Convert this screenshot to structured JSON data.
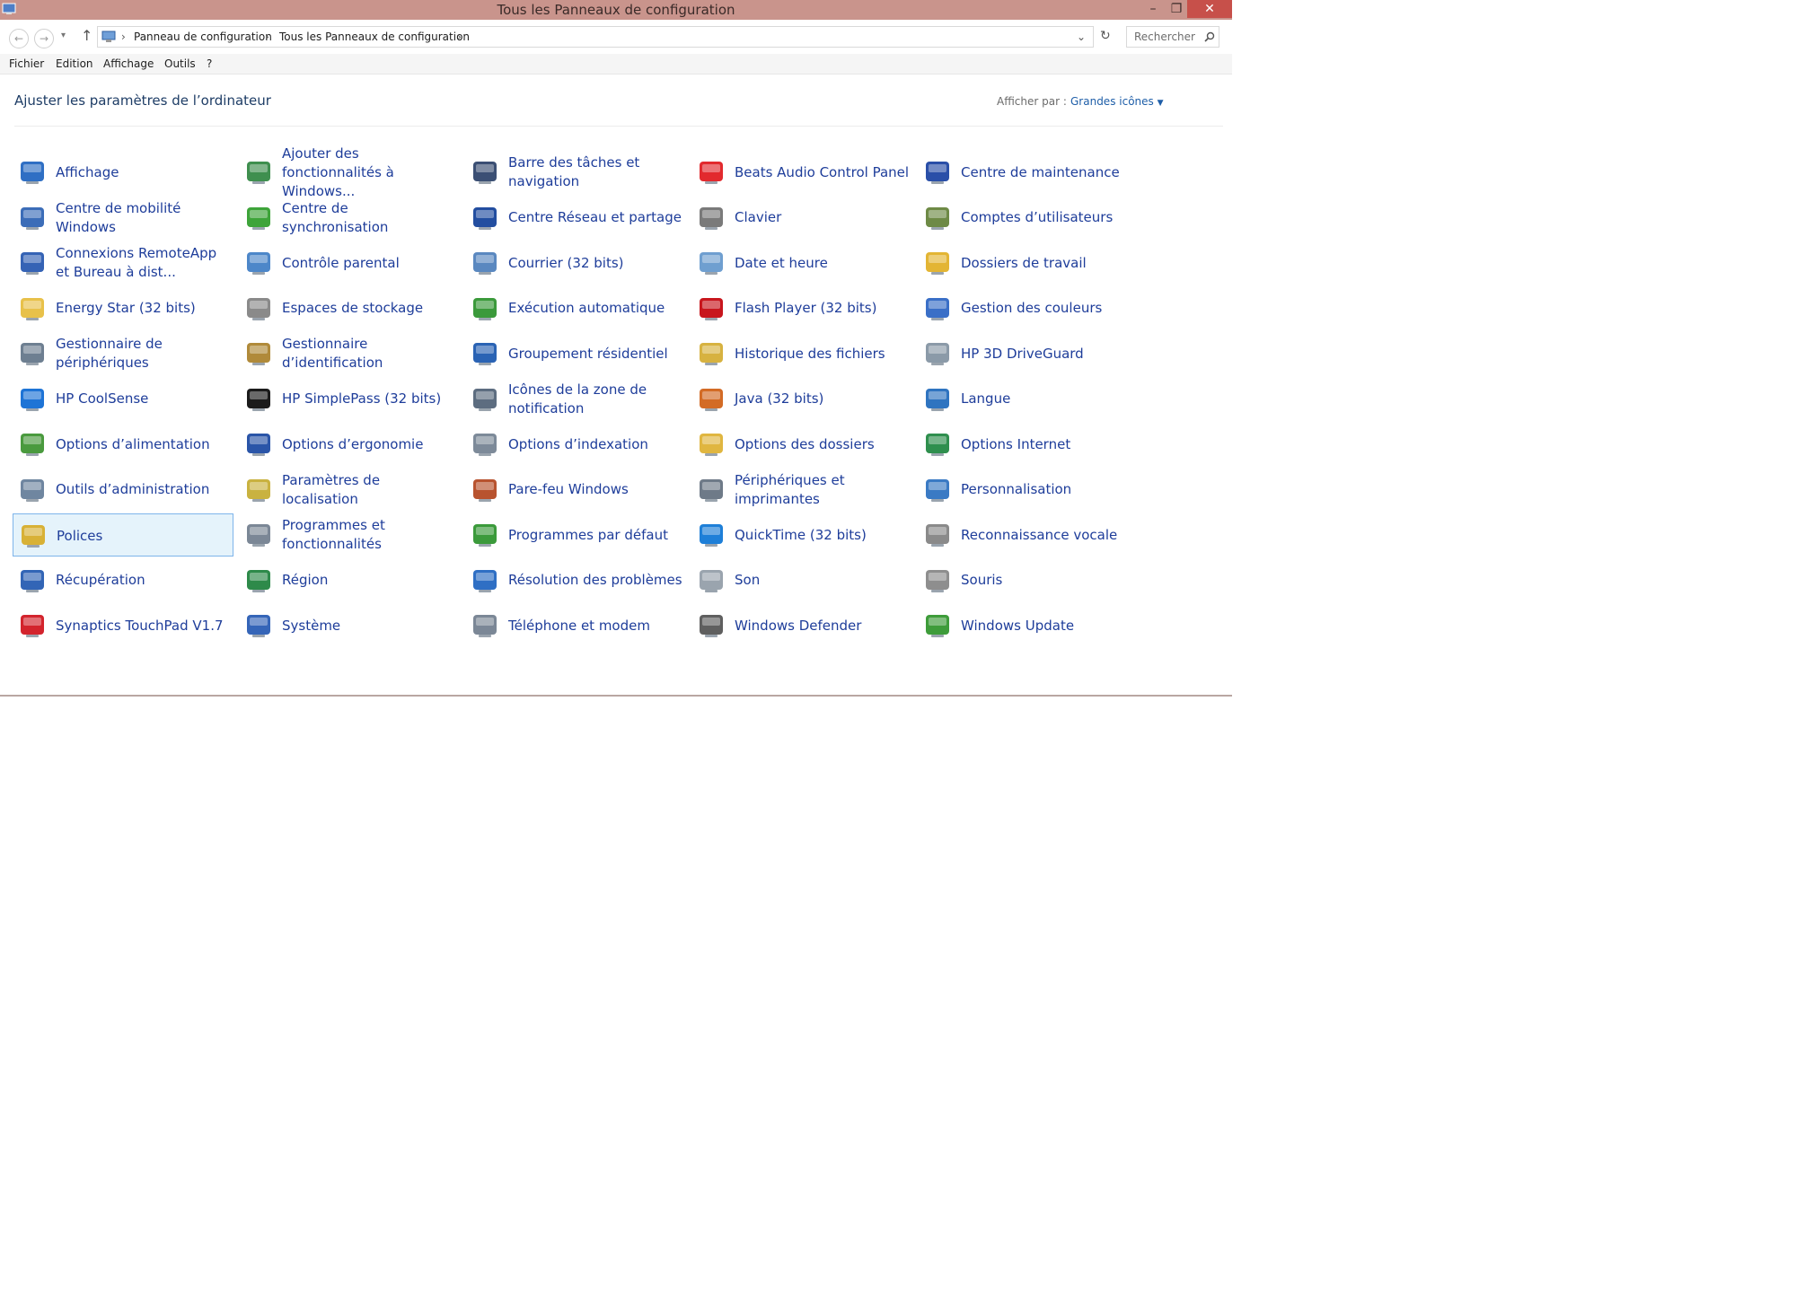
{
  "window": {
    "title": "Tous les Panneaux de configuration",
    "buttons": {
      "minimize": "–",
      "maximize": "❐",
      "close": "✕"
    }
  },
  "address": {
    "segments": [
      "Panneau de configuration",
      "Tous les Panneaux de configuration"
    ],
    "search_placeholder": "Rechercher"
  },
  "menu": [
    "Fichier",
    "Edition",
    "Affichage",
    "Outils",
    "?"
  ],
  "header": {
    "title": "Ajuster les paramètres de l’ordinateur",
    "view_by_label": "Afficher par :",
    "view_by_value": "Grandes icônes"
  },
  "items": [
    {
      "label": "Affichage",
      "icon": "display-icon",
      "color": "#2f6fc4"
    },
    {
      "label": "Ajouter des fonctionnalités à Windows...",
      "icon": "add-features-icon",
      "color": "#3f8f4f"
    },
    {
      "label": "Barre des tâches et navigation",
      "icon": "taskbar-icon",
      "color": "#3b4f74"
    },
    {
      "label": "Beats Audio Control Panel",
      "icon": "beats-icon",
      "color": "#e22a2e"
    },
    {
      "label": "Centre de maintenance",
      "icon": "flag-icon",
      "color": "#2a4fa8"
    },
    {
      "label": "Centre de mobilité Windows",
      "icon": "mobility-icon",
      "color": "#3c6db8"
    },
    {
      "label": "Centre de synchronisation",
      "icon": "sync-icon",
      "color": "#3ea43a"
    },
    {
      "label": "Centre Réseau et partage",
      "icon": "network-icon",
      "color": "#234ea0"
    },
    {
      "label": "Clavier",
      "icon": "keyboard-icon",
      "color": "#7a7a7a"
    },
    {
      "label": "Comptes d’utilisateurs",
      "icon": "users-icon",
      "color": "#6e8a46"
    },
    {
      "label": "Connexions RemoteApp et Bureau à dist...",
      "icon": "remote-icon",
      "color": "#3563b5"
    },
    {
      "label": "Contrôle parental",
      "icon": "parental-icon",
      "color": "#4d87c9"
    },
    {
      "label": "Courrier (32 bits)",
      "icon": "mail-icon",
      "color": "#5a88c0"
    },
    {
      "label": "Date et heure",
      "icon": "calendar-icon",
      "color": "#6f9fd0"
    },
    {
      "label": "Dossiers de travail",
      "icon": "work-folders-icon",
      "color": "#e3b534"
    },
    {
      "label": "Energy Star (32 bits)",
      "icon": "folder-icon",
      "color": "#e8c14a"
    },
    {
      "label": "Espaces de stockage",
      "icon": "storage-icon",
      "color": "#8a8a8a"
    },
    {
      "label": "Exécution automatique",
      "icon": "autoplay-icon",
      "color": "#3b9a3b"
    },
    {
      "label": "Flash Player (32 bits)",
      "icon": "flash-icon",
      "color": "#c8161d"
    },
    {
      "label": "Gestion des couleurs",
      "icon": "color-management-icon",
      "color": "#3a6fc7"
    },
    {
      "label": "Gestionnaire de périphériques",
      "icon": "device-manager-icon",
      "color": "#6e7f91"
    },
    {
      "label": "Gestionnaire d’identification",
      "icon": "credential-icon",
      "color": "#b08a3a"
    },
    {
      "label": "Groupement résidentiel",
      "icon": "homegroup-icon",
      "color": "#2a63b4"
    },
    {
      "label": "Historique des fichiers",
      "icon": "file-history-icon",
      "color": "#d7b240"
    },
    {
      "label": "HP 3D DriveGuard",
      "icon": "driveguard-icon",
      "color": "#8b9aa8"
    },
    {
      "label": "HP CoolSense",
      "icon": "snowflake-icon",
      "color": "#1e74d6"
    },
    {
      "label": "HP SimplePass (32 bits)",
      "icon": "fingerprint-icon",
      "color": "#1b1b1b"
    },
    {
      "label": "Icônes de la zone de notification",
      "icon": "notification-icon",
      "color": "#5d6d80"
    },
    {
      "label": "Java (32 bits)",
      "icon": "java-icon",
      "color": "#d36b25"
    },
    {
      "label": "Langue",
      "icon": "language-icon",
      "color": "#2f74c0"
    },
    {
      "label": "Options d’alimentation",
      "icon": "power-icon",
      "color": "#4a9a3e"
    },
    {
      "label": "Options d’ergonomie",
      "icon": "ease-of-access-icon",
      "color": "#2a55a8"
    },
    {
      "label": "Options d’indexation",
      "icon": "indexing-icon",
      "color": "#7d8a99"
    },
    {
      "label": "Options des dossiers",
      "icon": "folder-options-icon",
      "color": "#e0b640"
    },
    {
      "label": "Options Internet",
      "icon": "internet-icon",
      "color": "#2f8f4e"
    },
    {
      "label": "Outils d’administration",
      "icon": "admin-tools-icon",
      "color": "#6f86a0"
    },
    {
      "label": "Paramètres de localisation",
      "icon": "location-icon",
      "color": "#c9b240"
    },
    {
      "label": "Pare-feu Windows",
      "icon": "firewall-icon",
      "color": "#b8532f"
    },
    {
      "label": "Périphériques et imprimantes",
      "icon": "printer-icon",
      "color": "#6e7a88"
    },
    {
      "label": "Personnalisation",
      "icon": "personalization-icon",
      "color": "#3a7ac4"
    },
    {
      "label": "Polices",
      "icon": "fonts-icon",
      "color": "#d8b136"
    },
    {
      "label": "Programmes et fonctionnalités",
      "icon": "programs-icon",
      "color": "#7b8796"
    },
    {
      "label": "Programmes par défaut",
      "icon": "default-programs-icon",
      "color": "#3b9a3b"
    },
    {
      "label": "QuickTime (32 bits)",
      "icon": "quicktime-icon",
      "color": "#1e7fd8"
    },
    {
      "label": "Reconnaissance vocale",
      "icon": "microphone-icon",
      "color": "#8a8a8a"
    },
    {
      "label": "Récupération",
      "icon": "recovery-icon",
      "color": "#3265b6"
    },
    {
      "label": "Région",
      "icon": "region-icon",
      "color": "#2e8a4a"
    },
    {
      "label": "Résolution des problèmes",
      "icon": "troubleshoot-icon",
      "color": "#2f6fc4"
    },
    {
      "label": "Son",
      "icon": "speaker-icon",
      "color": "#9aa4ae"
    },
    {
      "label": "Souris",
      "icon": "mouse-icon",
      "color": "#8e8e8e"
    },
    {
      "label": "Synaptics TouchPad V1.7",
      "icon": "synaptics-icon",
      "color": "#d3242d"
    },
    {
      "label": "Système",
      "icon": "system-icon",
      "color": "#3565b8"
    },
    {
      "label": "Téléphone et modem",
      "icon": "phone-modem-icon",
      "color": "#7b8796"
    },
    {
      "label": "Windows Defender",
      "icon": "defender-icon",
      "color": "#5f5f5f"
    },
    {
      "label": "Windows Update",
      "icon": "windows-update-icon",
      "color": "#3e9c3a"
    }
  ],
  "selected_item": "Polices"
}
